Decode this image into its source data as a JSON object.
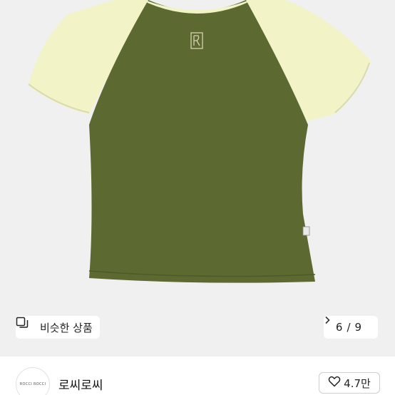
{
  "colors": {
    "shirt_body": "#5c6a32",
    "shirt_sleeve": "#f2f3c6",
    "background": "#f0f0f0",
    "logo": "#d8d1b0"
  },
  "image_overlay": {
    "similar_label": "비슷한 상품",
    "similar_icon": "similar-items-icon",
    "pager_current": "6",
    "pager_separator": "/",
    "pager_total": "9",
    "pager_icon": "chevron-right-icon"
  },
  "seller": {
    "avatar_text": "ROCCI ROCCI",
    "name": "로씨로씨",
    "like_icon": "heart-outline-icon",
    "like_count": "4.7만"
  }
}
